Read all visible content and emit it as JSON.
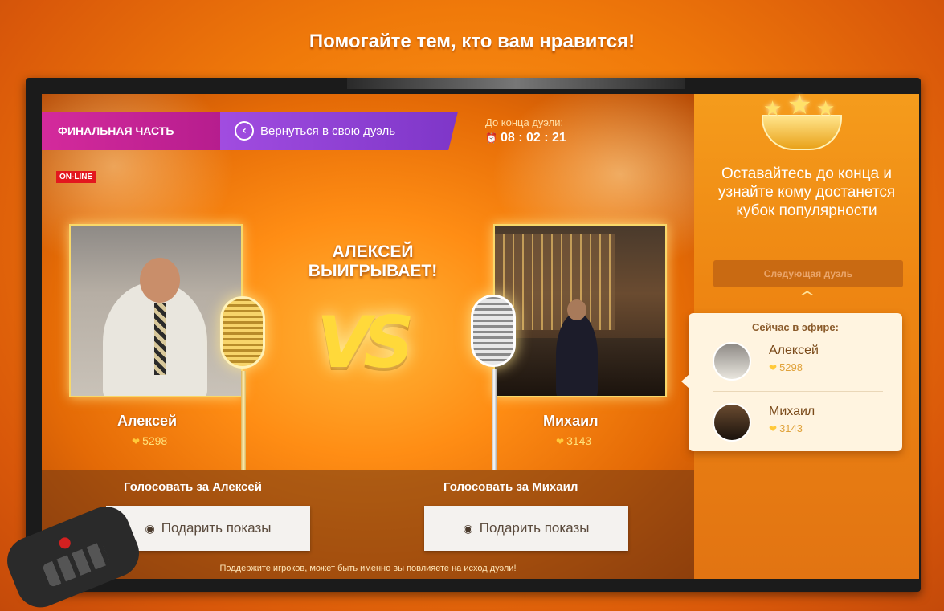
{
  "page": {
    "title": "Помогайте тем, кто вам нравится!"
  },
  "tabs": {
    "final": "ФИНАЛЬНАЯ ЧАСТЬ",
    "back": "Вернуться в свою дуэль"
  },
  "timer": {
    "label": "До конца дуэли:",
    "value": "08 : 02 : 21"
  },
  "online_badge": "ON-LINE",
  "duel": {
    "winner_text": "АЛЕКСЕЙ ВЫИГРЫВАЕТ!",
    "vs": "VS",
    "left": {
      "name": "Алексей",
      "score": "5298",
      "vote_label": "Голосовать за Алексей",
      "button": "Подарить показы"
    },
    "right": {
      "name": "Михаил",
      "score": "3143",
      "vote_label": "Голосовать за Михаил",
      "button": "Подарить показы"
    },
    "support_text": "Поддержите игроков, может быть именно вы повлияете на исход дуэли!"
  },
  "sidebar": {
    "message": "Оставайтесь до конца и узнайте кому достанется кубок популярности",
    "next_duel": "Следующая дуэль"
  },
  "live": {
    "title": "Сейчас в эфире:",
    "items": [
      {
        "name": "Алексей",
        "score": "5298"
      },
      {
        "name": "Михаил",
        "score": "3143"
      }
    ]
  },
  "colors": {
    "accent_pink": "#d42a9c",
    "accent_purple": "#8e3fd6",
    "background_orange": "#f07a0a",
    "online_red": "#e3171e"
  },
  "icons": {
    "back": "chevron-left-circle-icon",
    "clock": "clock-icon",
    "heart": "heart-icon",
    "eye": "eye-icon",
    "chevron_up": "chevron-up-icon"
  }
}
